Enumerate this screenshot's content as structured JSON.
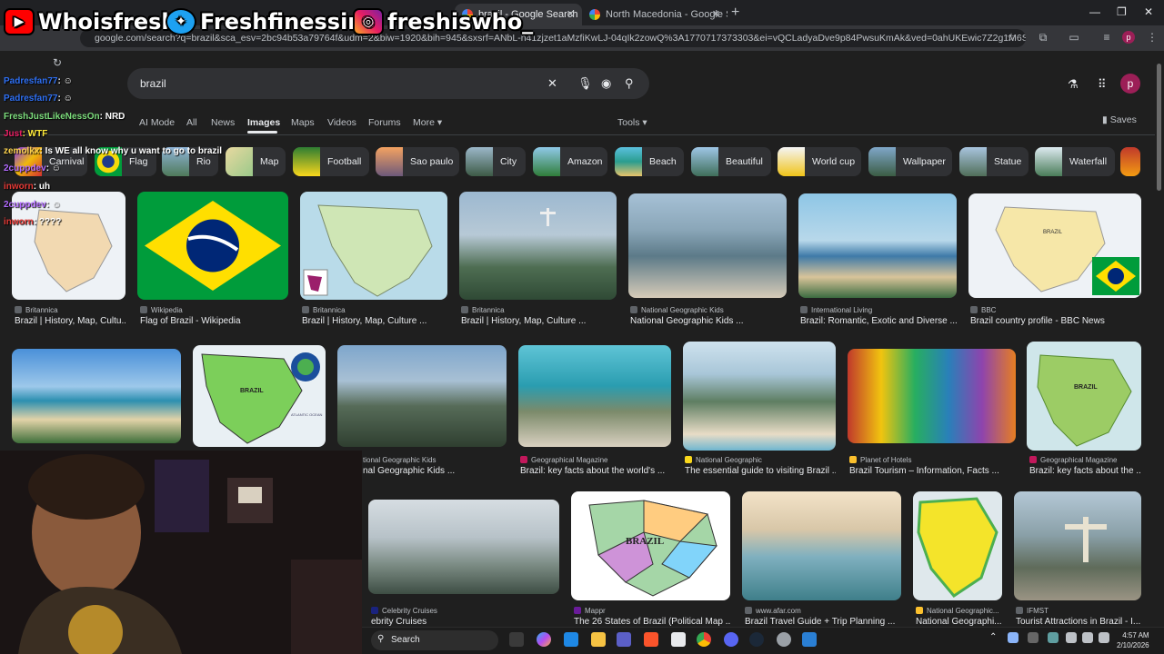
{
  "browser": {
    "tabs": [
      {
        "label": "brazil - Google Search",
        "active": true
      },
      {
        "label": "North Macedonia - Google Sea"
      }
    ],
    "url": "google.com/search?q=brazil&sca_esv=2bc94b53a79764f&udm=2&biw=1920&bih=945&sxsrf=ANbL-n41zjzet1aMzfiKwLJ-04qIk2zowQ%3A1770717373303&ei=vQCLadyaDve9p84PwsuKmAk&ved=0ahUKEwic7Z2g1M6SAxX33skDHcKIAp...",
    "profile_initial": "p"
  },
  "overlay": {
    "youtube": "Whoisfresh",
    "twitter": "Freshfinessing",
    "instagram": "freshiswho_"
  },
  "search": {
    "query": "brazil",
    "nav_tabs": [
      "AI Mode",
      "All",
      "News",
      "Images",
      "Maps",
      "Videos",
      "Forums",
      "More"
    ],
    "active_tab": "Images",
    "tools": "Tools",
    "saves": "Saves",
    "avatar_initial": "p"
  },
  "chips": [
    "Carnival",
    "Flag",
    "Rio",
    "Map",
    "Football",
    "Sao paulo",
    "City",
    "Amazon",
    "Beach",
    "Beautiful",
    "World cup",
    "Wallpaper",
    "Statue",
    "Waterfall"
  ],
  "results_row1": [
    {
      "source": "Britannica",
      "title": "Brazil | History, Map, Cultu..."
    },
    {
      "source": "Wikipedia",
      "title": "Flag of Brazil - Wikipedia"
    },
    {
      "source": "Britannica",
      "title": "Brazil | History, Map, Culture ..."
    },
    {
      "source": "Britannica",
      "title": "Brazil | History, Map, Culture ..."
    },
    {
      "source": "National Geographic Kids",
      "title": "National Geographic Kids ..."
    },
    {
      "source": "International Living",
      "title": "Brazil: Romantic, Exotic and Diverse ..."
    },
    {
      "source": "BBC",
      "title": "Brazil country profile - BBC News"
    }
  ],
  "results_row2": [
    {
      "source": "tional Geographic Kids",
      "title": "nal Geographic Kids ..."
    },
    {
      "source": "Geographical Magazine",
      "title": "Brazil: key facts about the world's ..."
    },
    {
      "source": "National Geographic",
      "title": "The essential guide to visiting Brazil ..."
    },
    {
      "source": "Planet of Hotels",
      "title": "Brazil Tourism – Information, Facts ..."
    },
    {
      "source": "Geographical Magazine",
      "title": "Brazil: key facts about the ..."
    }
  ],
  "results_row3": [
    {
      "source": "Celebrity Cruises",
      "title": "ebrity Cruises"
    },
    {
      "source": "Mappr",
      "title": "The 26 States of Brazil (Political Map ..."
    },
    {
      "source": "www.afar.com",
      "title": "Brazil Travel Guide + Trip Planning ..."
    },
    {
      "source": "National Geographic...",
      "title": "National Geographi..."
    },
    {
      "source": "IFMST",
      "title": "Tourist Attractions in Brazil - I..."
    }
  ],
  "chat": [
    {
      "user": "Padresfan77",
      "msg": ": ☺"
    },
    {
      "user": "Padresfan77",
      "msg": ": ☺"
    },
    {
      "user": "FreshJustLikeNessOn",
      "msg": ": NRD"
    },
    {
      "user": "Just",
      "msg": ": WTF"
    },
    {
      "user": "zemolkx",
      "msg": ": Is WE all know why u want to go to brazil"
    },
    {
      "user": "2cuppdev",
      "msg": ": ☺"
    },
    {
      "user": "inworn",
      "msg": ": uh"
    },
    {
      "user": "2cuppdev",
      "msg": ": ☺"
    },
    {
      "user": "inworn",
      "msg": ": ????"
    }
  ],
  "map_labels": {
    "brazil": "BRAZIL",
    "ocean": "ATLANTIC OCEAN"
  },
  "taskbar": {
    "search": "Search",
    "time": "4:57 AM",
    "date": "2/10/2026"
  },
  "colors": {
    "page_bg": "#1f1f1f",
    "searchbox": "#303134",
    "accent_text": "#e8eaed",
    "chat_name_blue": "#2e6ff2",
    "chat_name_purple": "#b36cff"
  }
}
